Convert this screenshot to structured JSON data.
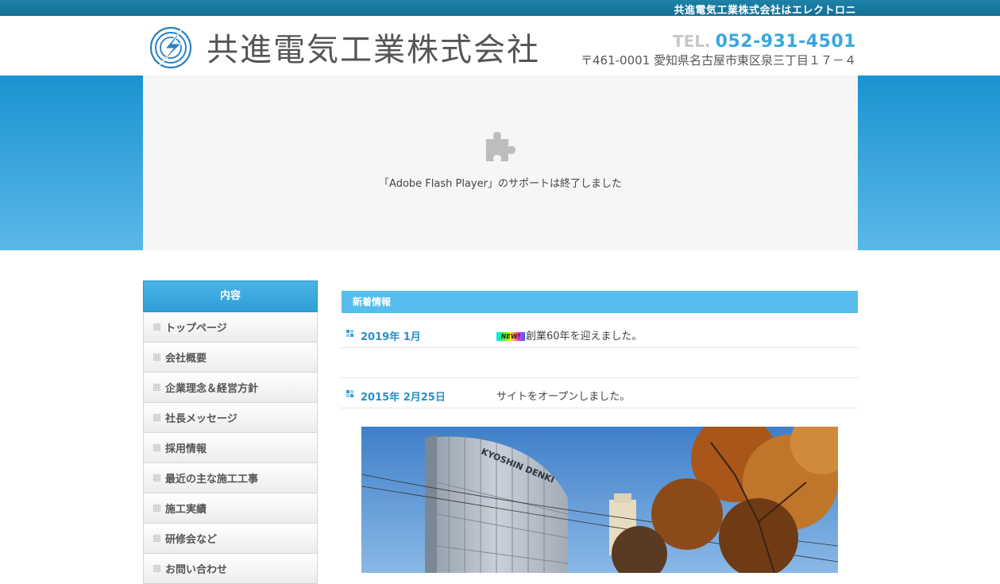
{
  "topbar": {
    "ticker_text": "共進電気工業株式会社はエレクトロニ"
  },
  "header": {
    "company_name": "共進電気工業株式会社",
    "tel_label": "TEL.",
    "tel_number": "052-931-4501",
    "address": "〒461-0001 愛知県名古屋市東区泉三丁目１７－４"
  },
  "hero": {
    "flash_message": "「Adobe Flash Player」のサポートは終了しました",
    "icon": "puzzle-piece-icon"
  },
  "sidebar": {
    "heading": "内容",
    "items": [
      {
        "label": "トップページ"
      },
      {
        "label": "会社概要"
      },
      {
        "label": "企業理念＆経営方針"
      },
      {
        "label": "社長メッセージ"
      },
      {
        "label": "採用情報"
      },
      {
        "label": "最近の主な施工工事"
      },
      {
        "label": "施工実績"
      },
      {
        "label": "研修会など"
      },
      {
        "label": "お問い合わせ"
      }
    ]
  },
  "news": {
    "heading": "新着情報",
    "badge": "NEW!",
    "items": [
      {
        "date": "2019年 1月",
        "text": "創業60年を迎えました。",
        "is_new": true
      },
      {
        "date": "",
        "text": "",
        "is_new": false
      },
      {
        "date": "2015年 2月25日",
        "text": "サイトをオープンしました。",
        "is_new": false
      }
    ]
  },
  "photo": {
    "building_sign": "KYOSHIN DENKI"
  },
  "colors": {
    "accent": "#3aa7dd",
    "topbar": "#146e93",
    "hero": "#1b93d0",
    "news_header": "#56bdee"
  }
}
